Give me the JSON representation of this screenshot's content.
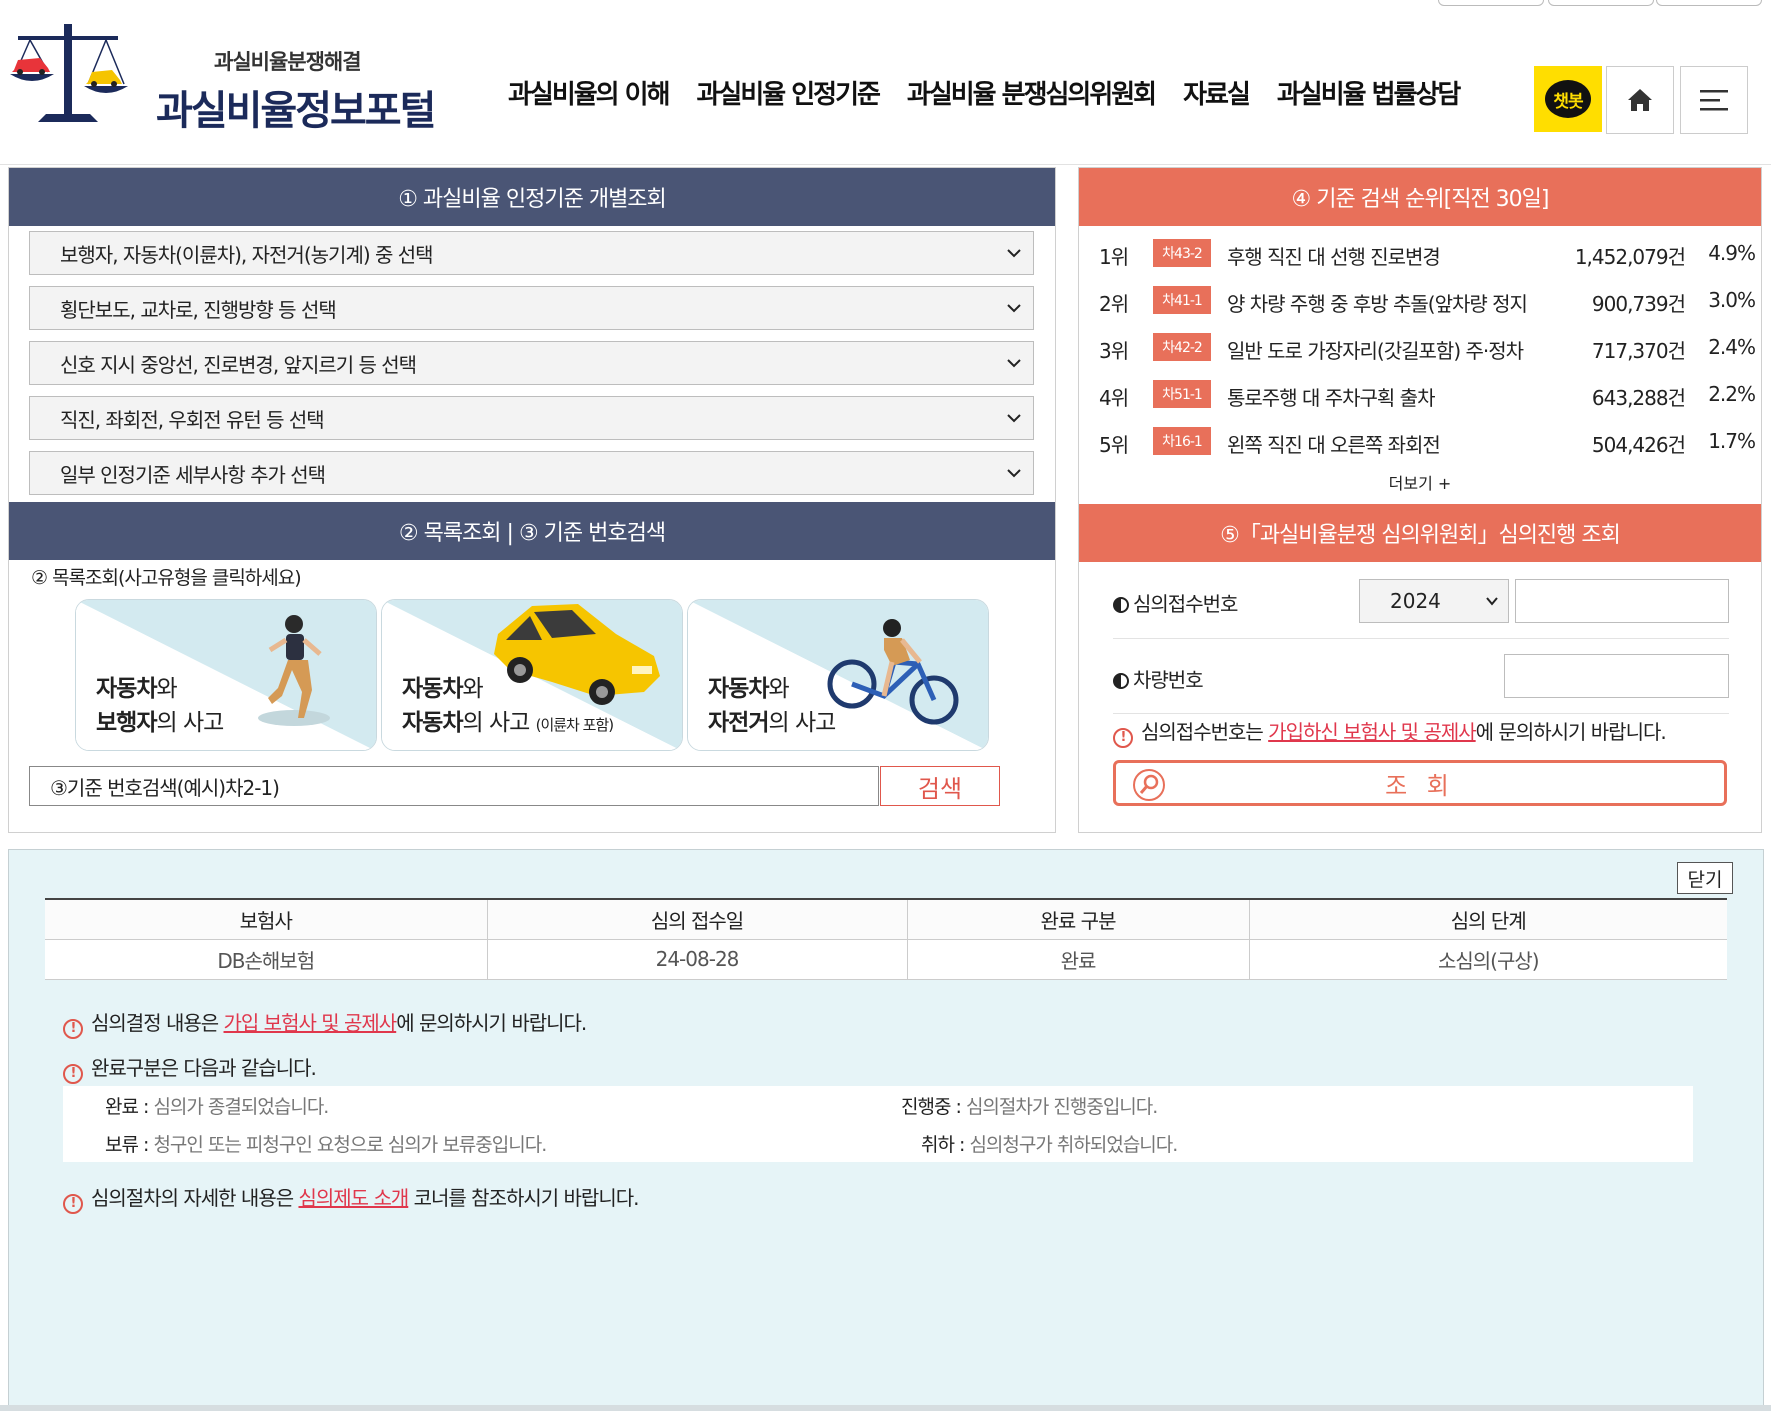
{
  "header": {
    "logo_sub": "과실비율분쟁해결",
    "logo_main": "과실비율정보포털",
    "nav": [
      "과실비율의 이해",
      "과실비율 인정기준",
      "과실비율 분쟁심의위원회",
      "자료실",
      "과실비율 법률상담"
    ],
    "chatbot_label": "챗봇",
    "home_icon": "home-icon",
    "menu_icon": "hamburger-menu-icon"
  },
  "left": {
    "section1_title": "① 과실비율 인정기준 개별조회",
    "selects": [
      "보행자, 자동차(이륜차), 자전거(농기계) 중 선택",
      "횡단보도, 교차로, 진행방향 등 선택",
      "신호 지시 중앙선, 진로변경, 앞지르기 등 선택",
      "직진, 좌회전, 우회전 유턴 등 선택",
      "일부 인정기준 세부사항 추가 선택"
    ],
    "section2_title": "② 목록조회 | ③ 기준 번호검색",
    "list_label": "② 목록조회(사고유형을 클릭하세요)",
    "cards": [
      {
        "line1_bold": "자동차",
        "line1_rest": "와",
        "line2_bold": "보행자",
        "line2_rest": "의 사고",
        "small": ""
      },
      {
        "line1_bold": "자동차",
        "line1_rest": "와",
        "line2_bold": "자동차",
        "line2_rest": "의 사고 ",
        "small": "(이륜차 포함)"
      },
      {
        "line1_bold": "자동차",
        "line1_rest": "와",
        "line2_bold": "자전거",
        "line2_rest": "의 사고",
        "small": ""
      }
    ],
    "search_placeholder": "③기준 번호검색(예시)차2-1)",
    "search_button": "검색"
  },
  "right": {
    "section4_title": "④ 기준 검색 순위[직전 30일]",
    "ranks": [
      {
        "rank": "1위",
        "code": "차43-2",
        "title": "후행 직진 대 선행 진로변경",
        "count": "1,452,079건",
        "pct": "4.9%"
      },
      {
        "rank": "2위",
        "code": "차41-1",
        "title": "양 차량 주행 중 후방 추돌(앞차량 정지",
        "count": "900,739건",
        "pct": "3.0%"
      },
      {
        "rank": "3위",
        "code": "차42-2",
        "title": "일반 도로 가장자리(갓길포함) 주·정차",
        "count": "717,370건",
        "pct": "2.4%"
      },
      {
        "rank": "4위",
        "code": "차51-1",
        "title": "통로주행 대 주차구획 출차",
        "count": "643,288건",
        "pct": "2.2%"
      },
      {
        "rank": "5위",
        "code": "차16-1",
        "title": "왼쪽 직진 대 오른쪽 좌회전",
        "count": "504,426건",
        "pct": "1.7%"
      }
    ],
    "more": "더보기 +",
    "section5_title": "⑤「과실비율분쟁 심의위원회」심의진행 조회",
    "receipt_label": "심의접수번호",
    "year_value": "2024",
    "vehicle_label": "차량번호",
    "notice_pre": "심의접수번호는 ",
    "notice_link": "가입하신 보험사 및 공제사",
    "notice_post": "에 문의하시기 바랍니다.",
    "query_button": "조 회"
  },
  "result": {
    "close_button": "닫기",
    "columns": [
      "보험사",
      "심의 접수일",
      "완료 구분",
      "심의 단계"
    ],
    "rows": [
      [
        "DB손해보험",
        "24-08-28",
        "완료",
        "소심의(구상)"
      ]
    ],
    "note1_pre": "심의결정 내용은 ",
    "note1_link": "가입 보험사 및 공제사",
    "note1_post": "에 문의하시기 바랍니다.",
    "note2": "완료구분은 다음과 같습니다.",
    "legend": [
      {
        "key": "완료 :",
        "value": "심의가 종결되었습니다."
      },
      {
        "key": "진행중 :",
        "value": "심의절차가 진행중입니다."
      },
      {
        "key": "보류 :",
        "value": "청구인 또는 피청구인 요청으로 심의가 보류중입니다."
      },
      {
        "key": "취하 :",
        "value": "심의청구가 취하되었습니다."
      }
    ],
    "note3_pre": "심의절차의 자세한 내용은 ",
    "note3_link": "심의제도 소개",
    "note3_post": " 코너를 참조하시기 바랍니다."
  },
  "colors": {
    "navy": "#4a5575",
    "coral": "#e8705a",
    "link_red": "#e0374c",
    "result_bg": "#e6f4f7",
    "chatbot_yellow": "#ffde00"
  }
}
